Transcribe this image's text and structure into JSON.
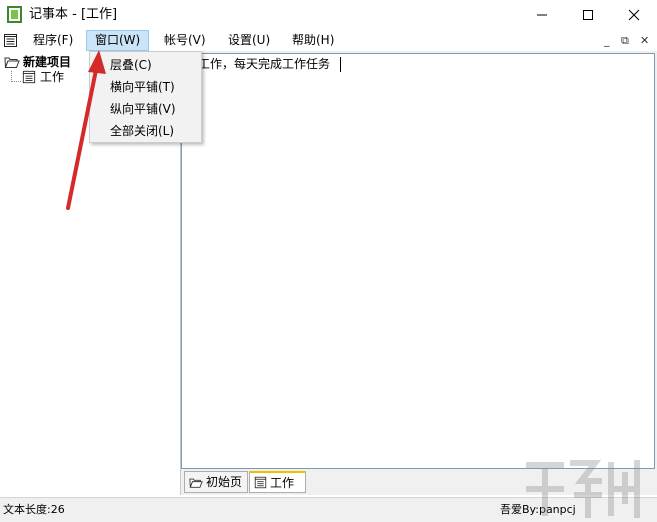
{
  "window": {
    "title": "记事本 - [工作]",
    "controls": {
      "minimize": "—",
      "maximize": "☐",
      "close": "✕"
    }
  },
  "menubar": {
    "items": [
      {
        "label": "程序(F)"
      },
      {
        "label": "窗口(W)",
        "active": true
      },
      {
        "label": "帐号(V)"
      },
      {
        "label": "设置(U)"
      },
      {
        "label": "帮助(H)"
      }
    ],
    "mdi_controls": {
      "minimize": "_",
      "restore": "⧉",
      "close": "✕"
    }
  },
  "window_menu": {
    "items": [
      {
        "label": "层叠(C)"
      },
      {
        "label": "横向平铺(T)"
      },
      {
        "label": "纵向平铺(V)"
      },
      {
        "label": "全部关闭(L)"
      }
    ]
  },
  "tree": {
    "root": "新建项目",
    "children": [
      {
        "label": "工作"
      }
    ]
  },
  "editor": {
    "content": "力工作，每天完成工作任务"
  },
  "tabs": [
    {
      "label": "初始页",
      "icon": "folder-icon",
      "selected": false
    },
    {
      "label": "工作",
      "icon": "notepad-icon",
      "selected": true
    }
  ],
  "statusbar": {
    "left": "文本长度:26",
    "right": "吾爱By:panpcj"
  },
  "colors": {
    "menu_highlight": "#cce4f7",
    "arrow": "#d42a2a",
    "tab_accent": "#f0c000"
  }
}
